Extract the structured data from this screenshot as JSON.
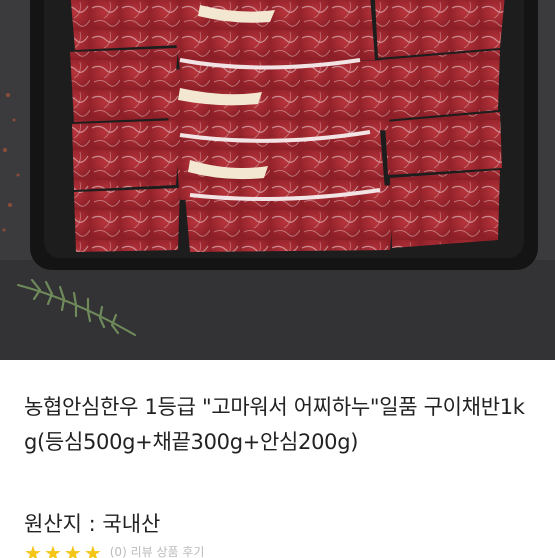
{
  "product": {
    "title": "농협안심한우 1등급 \"고마워서 어찌하누\"일품 구이채반1kg(등심500g+채끝300g+안심200g)",
    "origin_label": "원산지 : 국내산"
  },
  "rating": {
    "stars": [
      "★",
      "★",
      "★",
      "★"
    ],
    "text": "(0) 리뷰 상품 후기"
  },
  "colors": {
    "background": "#3a3a3c",
    "tray": "#151515",
    "meat": "#a8262f",
    "fat": "#f0e6e6",
    "star": "#f5c518"
  }
}
